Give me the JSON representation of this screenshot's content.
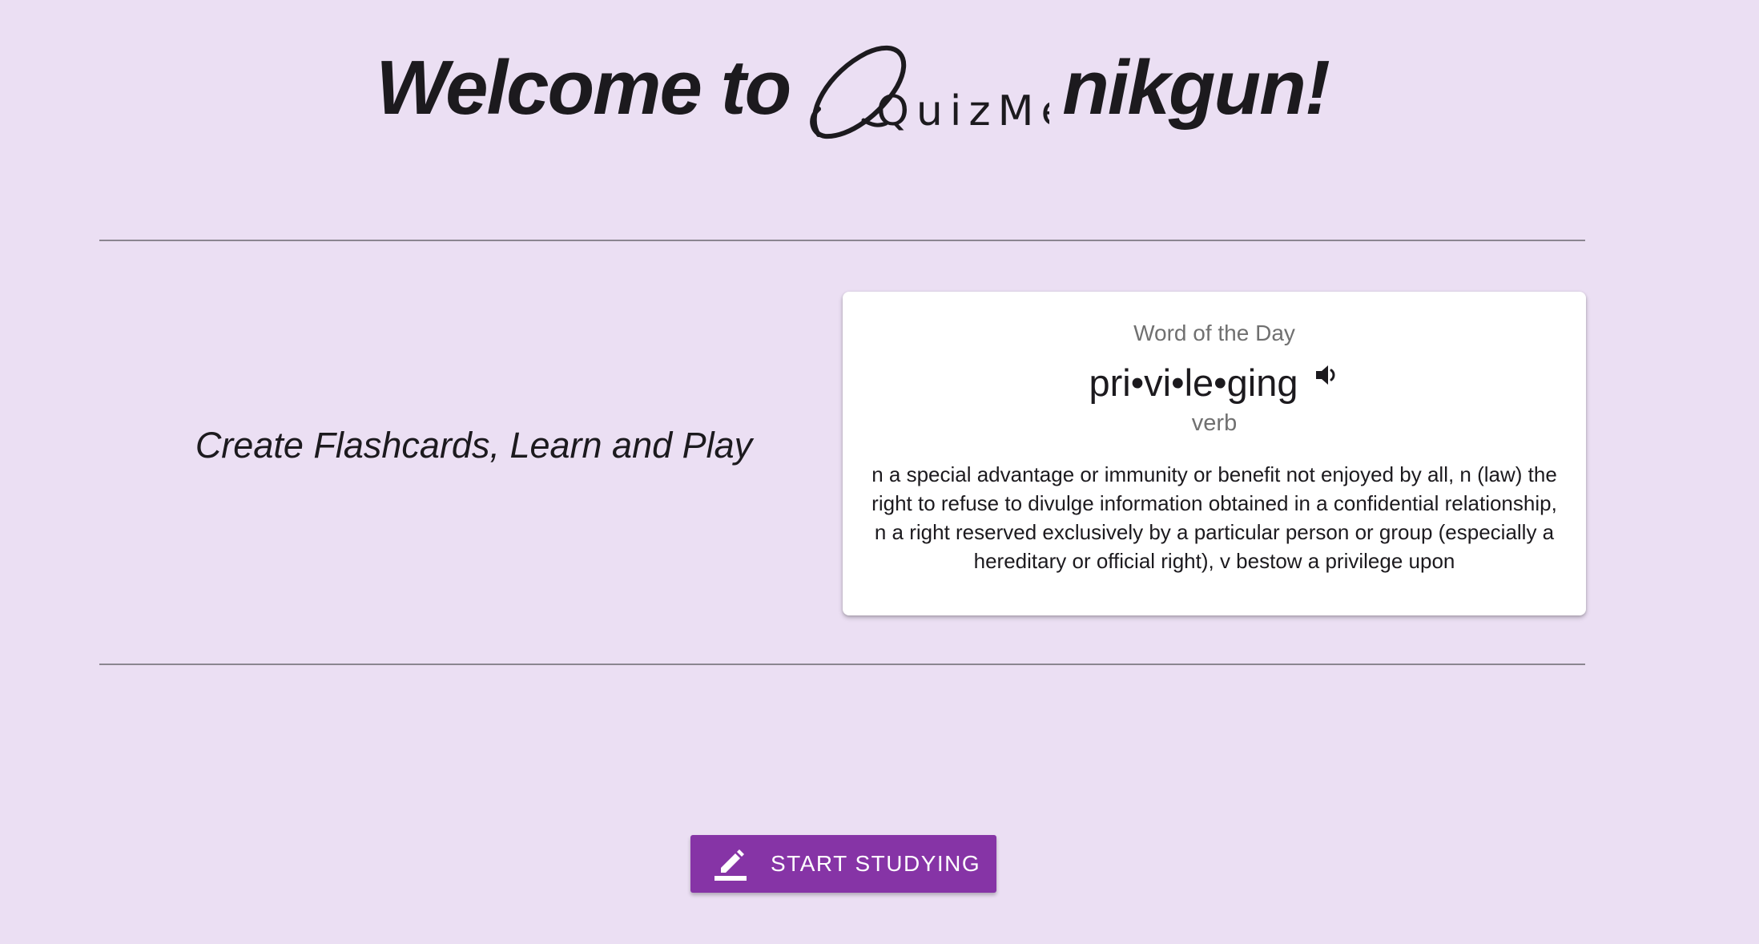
{
  "header": {
    "welcome_text": "Welcome to",
    "logo_text": "QuizMe",
    "username": "nikgun!"
  },
  "tagline": "Create Flashcards, Learn and Play",
  "word_of_day": {
    "title": "Word of the Day",
    "word": "pri•vi•le•ging",
    "part_of_speech": "verb",
    "definition": "n a special advantage or immunity or benefit not enjoyed by all, n (law) the right to refuse to divulge information obtained in a confidential relationship, n a right reserved exclusively by a particular person or group (especially a hereditary or official right), v bestow a privilege upon",
    "speaker_icon": "volume-icon"
  },
  "start_button": {
    "label": "START STUDYING",
    "icon": "edit-icon"
  },
  "colors": {
    "background": "#ebdff3",
    "button": "#8634a6",
    "card": "#ffffff",
    "muted_text": "#707070"
  }
}
